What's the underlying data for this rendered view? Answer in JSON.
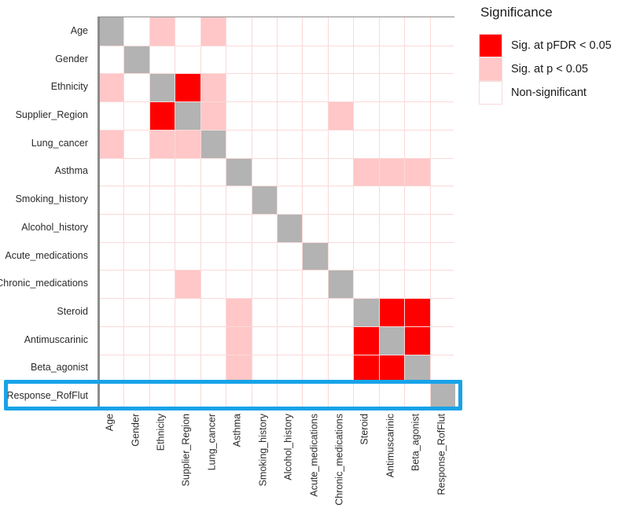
{
  "legend": {
    "title": "Significance",
    "keys": [
      {
        "label": "Sig. at pFDR < 0.05",
        "color": "#ff0000",
        "key": "fdr"
      },
      {
        "label": "Sig. at p < 0.05",
        "color": "#ffc7c7",
        "key": "p05"
      },
      {
        "label": "Non-significant",
        "color": "#ffffff",
        "key": "ns"
      }
    ]
  },
  "highlight": {
    "row_label": "Response_RofFlut",
    "color": "#18a3e8"
  },
  "colors": {
    "fdr": "#ff0000",
    "p05": "#ffc7c7",
    "ns": "#ffffff",
    "diagonal": "#b3b3b3",
    "gridline": "#fbd9d9",
    "panel_border": "#8c8c8c",
    "highlight": "#18a3e8"
  },
  "chart_data": {
    "type": "heatmap",
    "title": "",
    "xlabel": "",
    "ylabel": "",
    "legend_position": "right",
    "grid": true,
    "value_levels": {
      "0": "Non-significant",
      "1": "Sig. at p < 0.05",
      "2": "Sig. at pFDR < 0.05",
      "3": "Diagonal (self)"
    },
    "categories": [
      "Age",
      "Gender",
      "Ethnicity",
      "Supplier_Region",
      "Lung_cancer",
      "Asthma",
      "Smoking_history",
      "Alcohol_history",
      "Acute_medications",
      "Chronic_medications",
      "Steroid",
      "Antimuscarinic",
      "Beta_agonist",
      "Response_RofFlut"
    ],
    "x": [
      "Age",
      "Gender",
      "Ethnicity",
      "Supplier_Region",
      "Lung_cancer",
      "Asthma",
      "Smoking_history",
      "Alcohol_history",
      "Acute_medications",
      "Chronic_medications",
      "Steroid",
      "Antimuscarinic",
      "Beta_agonist",
      "Response_RofFlut"
    ],
    "y": [
      "Age",
      "Gender",
      "Ethnicity",
      "Supplier_Region",
      "Lung_cancer",
      "Asthma",
      "Smoking_history",
      "Alcohol_history",
      "Acute_medications",
      "Chronic_medications",
      "Steroid",
      "Antimuscarinic",
      "Beta_agonist",
      "Response_RofFlut"
    ],
    "rows_shown": [
      "Age",
      "Gender",
      "Ethnicity",
      "Supplier_Region",
      "Lung_cancer",
      "Asthma",
      "Smoking_history",
      "Alcohol_history",
      "Acute_medications",
      "Chronic_medications",
      "Steroid",
      "Antimuscarinic",
      "Beta_agonist",
      "Response_RofFlut"
    ],
    "columns_shown": [
      "Age",
      "Gender",
      "Ethnicity",
      "Supplier_Region",
      "Lung_cancer",
      "Asthma",
      "Smoking_history",
      "Alcohol_history",
      "Acute_medications",
      "Chronic_medications",
      "Steroid",
      "Antimuscarinic",
      "Beta_agonist",
      "Response_RofFlut"
    ],
    "values": [
      [
        3,
        0,
        1,
        0,
        1,
        0,
        0,
        0,
        0,
        0,
        0,
        0,
        0,
        0
      ],
      [
        0,
        3,
        0,
        0,
        0,
        0,
        0,
        0,
        0,
        0,
        0,
        0,
        0,
        0
      ],
      [
        1,
        0,
        3,
        2,
        1,
        0,
        0,
        0,
        0,
        0,
        0,
        0,
        0,
        0
      ],
      [
        0,
        0,
        2,
        3,
        1,
        0,
        0,
        0,
        0,
        1,
        0,
        0,
        0,
        0
      ],
      [
        1,
        0,
        1,
        1,
        3,
        0,
        0,
        0,
        0,
        0,
        0,
        0,
        0,
        0
      ],
      [
        0,
        0,
        0,
        0,
        0,
        3,
        0,
        0,
        0,
        0,
        1,
        1,
        1,
        0
      ],
      [
        0,
        0,
        0,
        0,
        0,
        0,
        3,
        0,
        0,
        0,
        0,
        0,
        0,
        0
      ],
      [
        0,
        0,
        0,
        0,
        0,
        0,
        0,
        3,
        0,
        0,
        0,
        0,
        0,
        0
      ],
      [
        0,
        0,
        0,
        0,
        0,
        0,
        0,
        0,
        3,
        0,
        0,
        0,
        0,
        0
      ],
      [
        0,
        0,
        0,
        1,
        0,
        0,
        0,
        0,
        0,
        3,
        0,
        0,
        0,
        0
      ],
      [
        0,
        0,
        0,
        0,
        0,
        1,
        0,
        0,
        0,
        0,
        3,
        2,
        2,
        0
      ],
      [
        0,
        0,
        0,
        0,
        0,
        1,
        0,
        0,
        0,
        0,
        2,
        3,
        2,
        0
      ],
      [
        0,
        0,
        0,
        0,
        0,
        1,
        0,
        0,
        0,
        0,
        2,
        2,
        3,
        0
      ],
      [
        0,
        0,
        0,
        0,
        0,
        0,
        0,
        0,
        0,
        0,
        0,
        0,
        0,
        3
      ]
    ]
  }
}
